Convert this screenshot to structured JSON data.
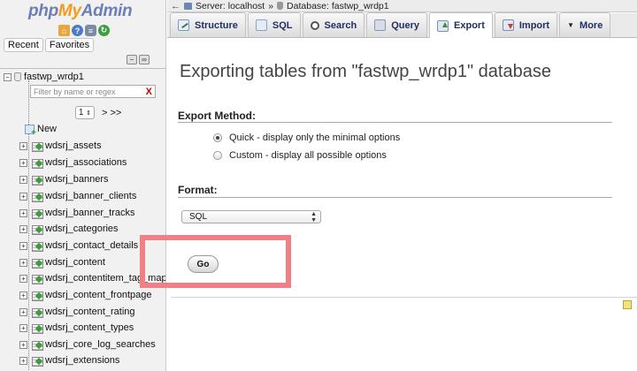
{
  "sidebar": {
    "logo": {
      "php": "php",
      "my": "My",
      "admin": "Admin"
    },
    "logo_icons": [
      "home-icon",
      "help-icon",
      "docs-icon",
      "reload-icon"
    ],
    "nav_tabs": [
      "Recent",
      "Favorites"
    ],
    "database": "fastwp_wrdp1",
    "filter_placeholder": "Filter by name or regex",
    "filter_clear": "X",
    "page_number": "1",
    "pager_next": "> >>",
    "new_label": "New",
    "tables": [
      "wdsrj_assets",
      "wdsrj_associations",
      "wdsrj_banners",
      "wdsrj_banner_clients",
      "wdsrj_banner_tracks",
      "wdsrj_categories",
      "wdsrj_contact_details",
      "wdsrj_content",
      "wdsrj_contentitem_tag_map",
      "wdsrj_content_frontpage",
      "wdsrj_content_rating",
      "wdsrj_content_types",
      "wdsrj_core_log_searches",
      "wdsrj_extensions"
    ]
  },
  "breadcrumb": {
    "back": "←",
    "server": "Server: localhost",
    "sep": "»",
    "database": "Database: fastwp_wrdp1"
  },
  "tabs": [
    {
      "label": "Structure",
      "icon": "structure-icon"
    },
    {
      "label": "SQL",
      "icon": "sql-icon"
    },
    {
      "label": "Search",
      "icon": "search-icon"
    },
    {
      "label": "Query",
      "icon": "query-icon"
    },
    {
      "label": "Export",
      "icon": "export-icon",
      "active": true
    },
    {
      "label": "Import",
      "icon": "import-icon"
    },
    {
      "label": "More",
      "icon": "chevron-down-icon"
    }
  ],
  "main": {
    "title": "Exporting tables from \"fastwp_wrdp1\" database",
    "export_method_label": "Export Method:",
    "options": [
      {
        "label": "Quick - display only the minimal options",
        "checked": true
      },
      {
        "label": "Custom - display all possible options",
        "checked": false
      }
    ],
    "format_label": "Format:",
    "format_value": "SQL",
    "go_label": "Go"
  },
  "colors": {
    "highlight": "#f07f86",
    "tab_text": "#213064",
    "logo_blue": "#6b7eb9",
    "logo_orange": "#f29c1f"
  }
}
